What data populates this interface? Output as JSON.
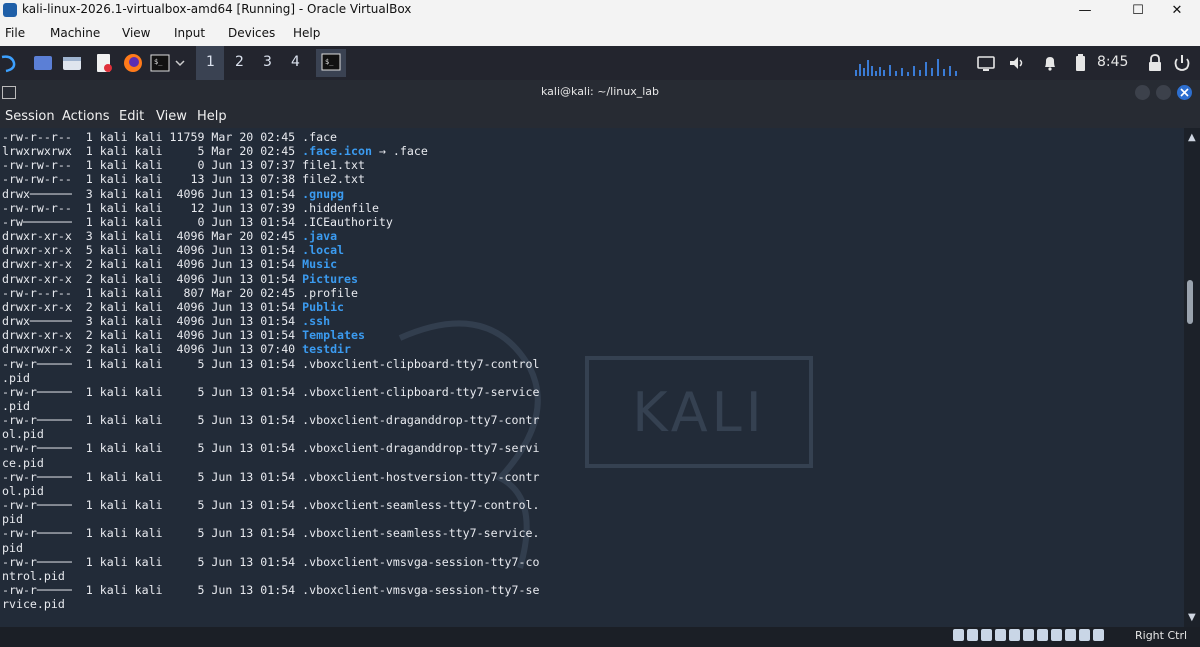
{
  "window": {
    "title": "kali-linux-2026.1-virtualbox-amd64 [Running] - Oracle VirtualBox",
    "minimize": "—",
    "maximize": "☐",
    "close": "✕"
  },
  "menubar": {
    "file": "File",
    "machine": "Machine",
    "view": "View",
    "input": "Input",
    "devices": "Devices",
    "help": "Help"
  },
  "panel": {
    "ws1": "1",
    "ws2": "2",
    "ws3": "3",
    "ws4": "4",
    "clock": "8:45"
  },
  "terminal": {
    "title": "kali@kali: ~/linux_lab",
    "menu": {
      "session": "Session",
      "actions": "Actions",
      "edit": "Edit",
      "view": "View",
      "help": "Help"
    },
    "watermark": "KALI",
    "output": [
      {
        "t": "-rw-r--r--  1 kali kali 11759 Mar 20 02:45 .face"
      },
      {
        "t": "lrwxrwxrwx  1 kali kali     5 Mar 20 02:45 ",
        "d": ".face.icon",
        "s": " → .face"
      },
      {
        "t": "-rw-rw-r--  1 kali kali     0 Jun 13 07:37 file1.txt"
      },
      {
        "t": "-rw-rw-r--  1 kali kali    13 Jun 13 07:38 file2.txt"
      },
      {
        "t": "drwx──────  3 kali kali  4096 Jun 13 01:54 ",
        "d": ".gnupg"
      },
      {
        "t": "-rw-rw-r--  1 kali kali    12 Jun 13 07:39 .hiddenfile"
      },
      {
        "t": "-rw───────  1 kali kali     0 Jun 13 01:54 .ICEauthority"
      },
      {
        "t": "drwxr-xr-x  3 kali kali  4096 Mar 20 02:45 ",
        "d": ".java"
      },
      {
        "t": "drwxr-xr-x  5 kali kali  4096 Jun 13 01:54 ",
        "d": ".local"
      },
      {
        "t": "drwxr-xr-x  2 kali kali  4096 Jun 13 01:54 ",
        "d": "Music"
      },
      {
        "t": "drwxr-xr-x  2 kali kali  4096 Jun 13 01:54 ",
        "d": "Pictures"
      },
      {
        "t": "-rw-r--r--  1 kali kali   807 Mar 20 02:45 .profile"
      },
      {
        "t": "drwxr-xr-x  2 kali kali  4096 Jun 13 01:54 ",
        "d": "Public"
      },
      {
        "t": "drwx──────  3 kali kali  4096 Jun 13 01:54 ",
        "d": ".ssh"
      },
      {
        "t": "drwxr-xr-x  2 kali kali  4096 Jun 13 01:54 ",
        "d": "Templates"
      },
      {
        "t": "drwxrwxr-x  2 kali kali  4096 Jun 13 07:40 ",
        "d": "testdir"
      },
      {
        "t": "-rw-r─────  1 kali kali     5 Jun 13 01:54 .vboxclient-clipboard-tty7-control"
      },
      {
        "t": ".pid"
      },
      {
        "t": "-rw-r─────  1 kali kali     5 Jun 13 01:54 .vboxclient-clipboard-tty7-service"
      },
      {
        "t": ".pid"
      },
      {
        "t": "-rw-r─────  1 kali kali     5 Jun 13 01:54 .vboxclient-draganddrop-tty7-contr"
      },
      {
        "t": "ol.pid"
      },
      {
        "t": "-rw-r─────  1 kali kali     5 Jun 13 01:54 .vboxclient-draganddrop-tty7-servi"
      },
      {
        "t": "ce.pid"
      },
      {
        "t": "-rw-r─────  1 kali kali     5 Jun 13 01:54 .vboxclient-hostversion-tty7-contr"
      },
      {
        "t": "ol.pid"
      },
      {
        "t": "-rw-r─────  1 kali kali     5 Jun 13 01:54 .vboxclient-seamless-tty7-control."
      },
      {
        "t": "pid"
      },
      {
        "t": "-rw-r─────  1 kali kali     5 Jun 13 01:54 .vboxclient-seamless-tty7-service."
      },
      {
        "t": "pid"
      },
      {
        "t": "-rw-r─────  1 kali kali     5 Jun 13 01:54 .vboxclient-vmsvga-session-tty7-co"
      },
      {
        "t": "ntrol.pid"
      },
      {
        "t": "-rw-r─────  1 kali kali     5 Jun 13 01:54 .vboxclient-vmsvga-session-tty7-se"
      },
      {
        "t": "rvice.pid"
      }
    ]
  },
  "status": {
    "hostkey": "Right Ctrl"
  },
  "colors": {
    "terminal_bg": "#222b38",
    "directory": "#3b9bf0",
    "panel_bg": "#23252e"
  }
}
